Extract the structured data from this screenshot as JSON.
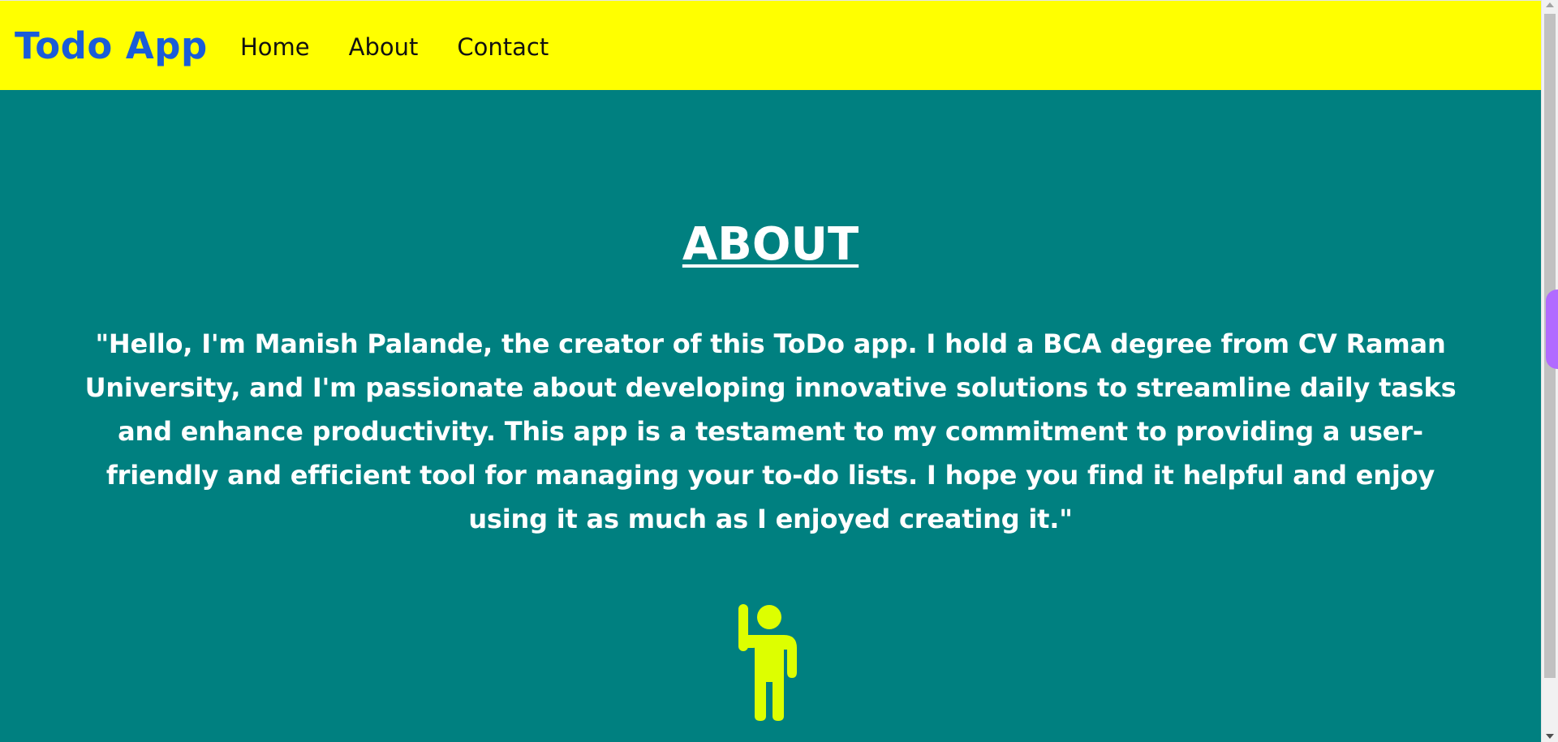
{
  "navbar": {
    "brand": "Todo App",
    "links": [
      "Home",
      "About",
      "Contact"
    ],
    "background_color": "#ffff00",
    "brand_color": "#1a5cd8"
  },
  "about": {
    "heading": "ABOUT",
    "paragraph": "\"Hello, I'm Manish Palande, the creator of this ToDo app. I hold a BCA degree from CV Raman University, and I'm passionate about developing innovative solutions to streamline daily tasks and enhance productivity. This app is a testament to my commitment to providing a user-friendly and efficient tool for managing your to-do lists. I hope you find it helpful and enjoy using it as much as I enjoyed creating it.\"",
    "icon": "person-waving-icon",
    "icon_color": "#ddff00",
    "background_color": "#008080"
  }
}
